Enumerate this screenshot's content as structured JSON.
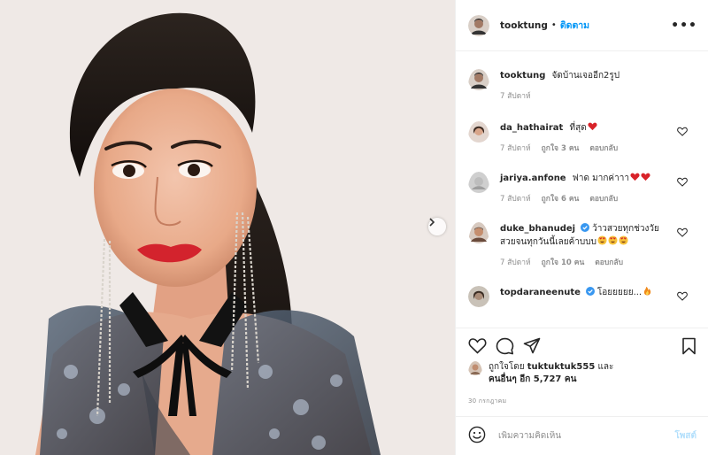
{
  "post": {
    "username": "tooktung",
    "follow_label": "ติดตาม",
    "more_label": "•••"
  },
  "caption": {
    "username": "tooktung",
    "text": "จัดบ้านเจออีก2รูป",
    "time": "7 สัปดาห์"
  },
  "comments": [
    {
      "username": "da_hathairat",
      "text": "ที่สุด",
      "emoji": [
        "red-heart-emoji"
      ],
      "time": "7 สัปดาห์",
      "likes": "ถูกใจ 3 คน",
      "reply": "ตอบกลับ",
      "verified": false
    },
    {
      "username": "jariya.anfone",
      "text": "ฟาด มากค่าาา",
      "emoji": [
        "red-heart-emoji",
        "red-heart-emoji"
      ],
      "time": "7 สัปดาห์",
      "likes": "ถูกใจ 6 คน",
      "reply": "ตอบกลับ",
      "verified": false
    },
    {
      "username": "duke_bhanudej",
      "text": "ว้าวสวยทุกช่วงวัย สวยจนทุกวันนี้เลยค้าบบบ",
      "emoji": [
        "heart-eyes-emoji",
        "heart-eyes-emoji",
        "heart-eyes-emoji"
      ],
      "time": "7 สัปดาห์",
      "likes": "ถูกใจ 10 คน",
      "reply": "ตอบกลับ",
      "verified": true
    },
    {
      "username": "topdaraneenute",
      "text": "โอยยยยย...",
      "emoji": [
        "fire-emoji"
      ],
      "time": "",
      "likes": "",
      "reply": "",
      "verified": true
    }
  ],
  "likes": {
    "prefix": "ถูกใจโดย",
    "user": "tuktuktuk555",
    "joiner": "และ",
    "others": "คนอื่นๆ อีก 5,727 คน"
  },
  "date": "30 กรกฎาคม",
  "add_comment": {
    "placeholder": "เพิ่มความคิดเห็น",
    "post_label": "โพสต์"
  },
  "icons": {
    "like": "heart-outline-icon",
    "comment": "comment-bubble-icon",
    "share": "paper-plane-icon",
    "save": "bookmark-icon",
    "emoji": "smiley-face-icon",
    "next": "chevron-right-icon"
  },
  "colors": {
    "link": "#0095f6",
    "post_button_disabled": "#b2dffc",
    "heart_red": "#d8232a",
    "verified": "#3897f0"
  }
}
